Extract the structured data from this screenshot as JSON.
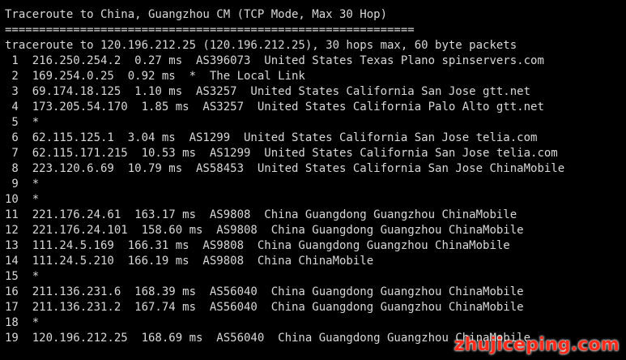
{
  "terminal": {
    "header": {
      "title": "Traceroute to China, Guangzhou CM (TCP Mode, Max 30 Hop)",
      "separator": "============================================================",
      "command_output": "traceroute to 120.196.212.25 (120.196.212.25), 30 hops max, 60 byte packets"
    },
    "hops": [
      " 1  216.250.254.2  0.27 ms  AS396073  United States Texas Plano spinservers.com",
      " 2  169.254.0.25  0.92 ms  *  The Local Link",
      " 3  69.174.18.125  1.10 ms  AS3257  United States California San Jose gtt.net",
      " 4  173.205.54.170  1.85 ms  AS3257  United States California Palo Alto gtt.net",
      " 5  *",
      " 6  62.115.125.1  3.04 ms  AS1299  United States California San Jose telia.com",
      " 7  62.115.171.215  10.53 ms  AS1299  United States California San Jose telia.com",
      " 8  223.120.6.69  10.79 ms  AS58453  United States California San Jose ChinaMobile",
      " 9  *",
      "10  *",
      "11  221.176.24.61  163.17 ms  AS9808  China Guangdong Guangzhou ChinaMobile",
      "12  221.176.24.101  158.60 ms  AS9808  China Guangdong Guangzhou ChinaMobile",
      "13  111.24.5.169  166.31 ms  AS9808  China Guangdong Guangzhou ChinaMobile",
      "14  111.24.5.210  166.19 ms  AS9808  China ChinaMobile",
      "15  *",
      "16  211.136.231.6  168.39 ms  AS56040  China Guangdong Guangzhou ChinaMobile",
      "17  211.136.231.2  167.74 ms  AS56040  China Guangdong Guangzhou ChinaMobile",
      "18  *",
      "19  120.196.212.25  168.69 ms  AS56040  China Guangdong Guangzhou ChinaMobile"
    ]
  },
  "watermark": {
    "text": "zhujiceping.com"
  },
  "colors": {
    "background": "#000000",
    "text": "#d8d8d8",
    "watermark": "#ff2a1a"
  }
}
